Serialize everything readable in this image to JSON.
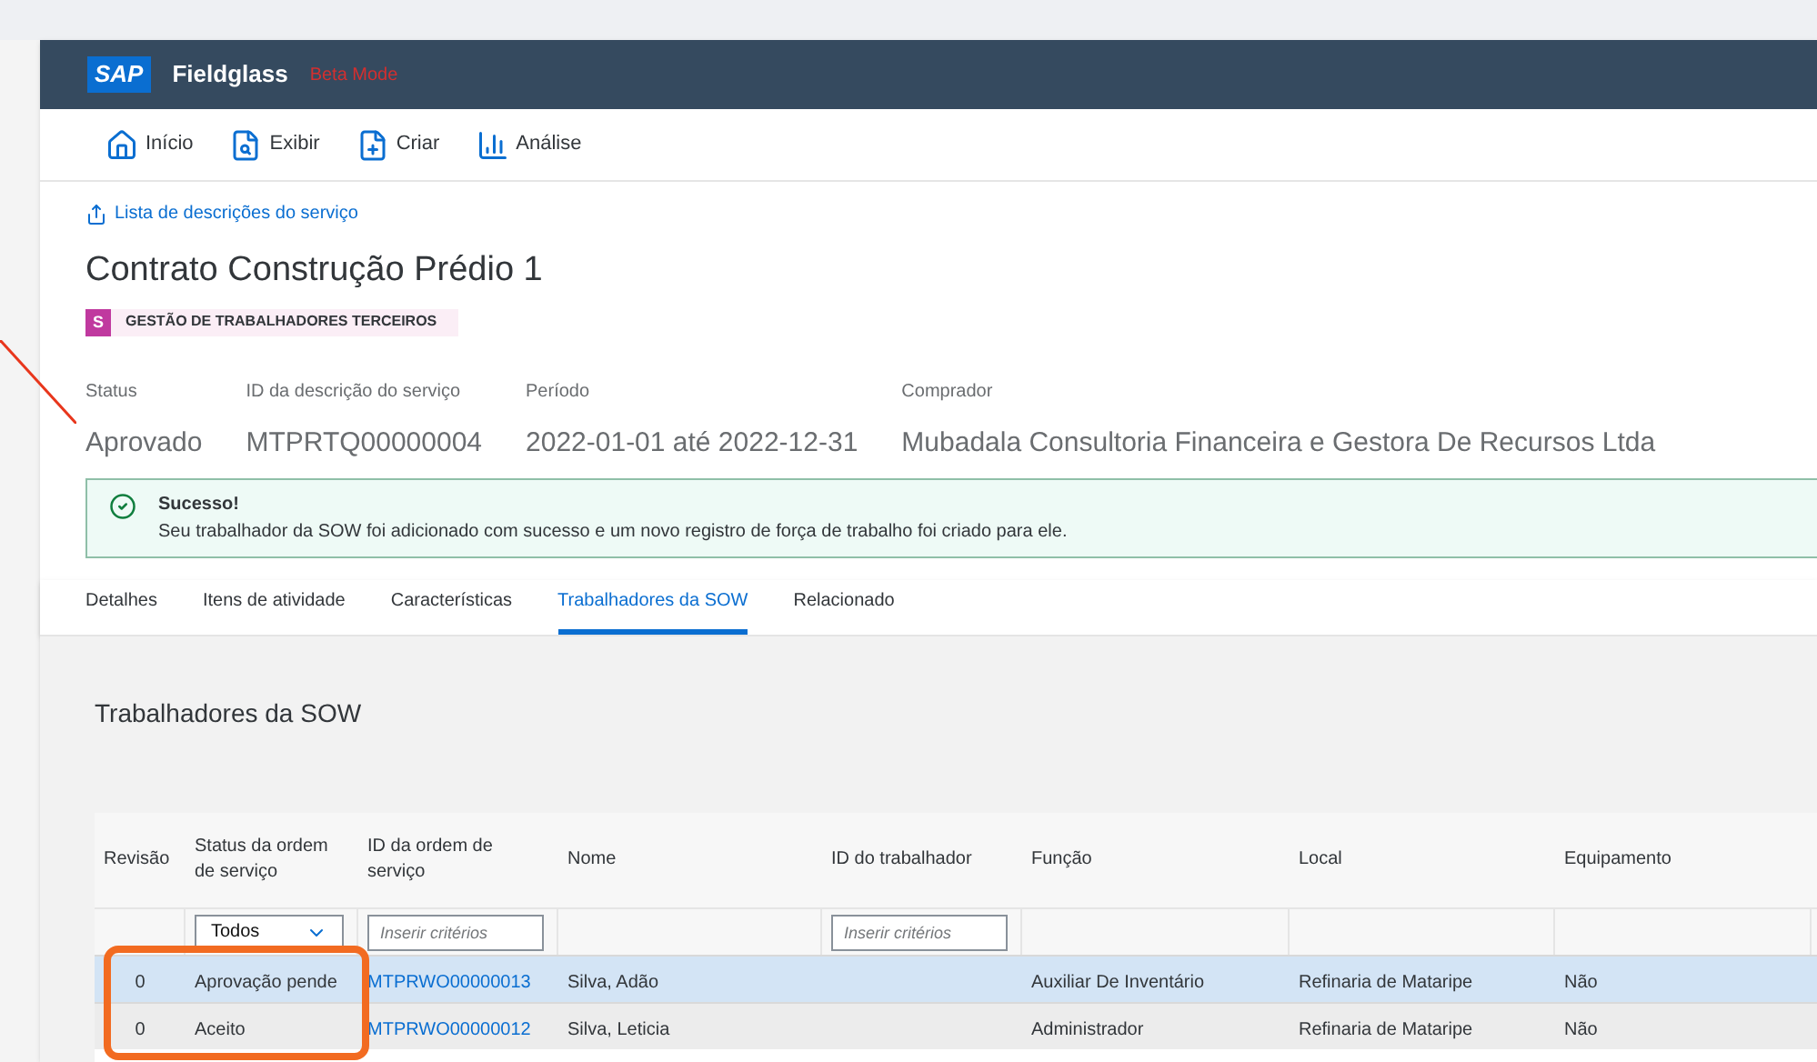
{
  "header": {
    "logo": "SAP",
    "product": "Fieldglass",
    "mode": "Beta Mode"
  },
  "nav": [
    {
      "label": "Início"
    },
    {
      "label": "Exibir"
    },
    {
      "label": "Criar"
    },
    {
      "label": "Análise"
    }
  ],
  "breadcrumb": "Lista de descrições do serviço",
  "title": "Contrato Construção Prédio 1",
  "badge": {
    "letter": "S",
    "label": "GESTÃO DE TRABALHADORES TERCEIROS"
  },
  "fields": [
    {
      "label": "Status",
      "value": "Aprovado"
    },
    {
      "label": "ID da descrição do serviço",
      "value": "MTPRTQ00000004"
    },
    {
      "label": "Período",
      "value": "2022-01-01 até 2022-12-31"
    },
    {
      "label": "Comprador",
      "value": "Mubadala Consultoria Financeira e Gestora De Recursos Ltda"
    }
  ],
  "message": {
    "title": "Sucesso!",
    "text": "Seu trabalhador da SOW foi adicionado com sucesso e um novo registro de força de trabalho foi criado para ele."
  },
  "tabs": [
    {
      "label": "Detalhes",
      "selected": false
    },
    {
      "label": "Itens de atividade",
      "selected": false
    },
    {
      "label": "Características",
      "selected": false
    },
    {
      "label": "Trabalhadores da SOW",
      "selected": true
    },
    {
      "label": "Relacionado",
      "selected": false
    }
  ],
  "section_title": "Trabalhadores da SOW",
  "table": {
    "columns": [
      {
        "label": "Revisão"
      },
      {
        "label": "Status da ordem de serviço",
        "filter": {
          "kind": "select",
          "value": "Todos"
        }
      },
      {
        "label": "ID da ordem de serviço",
        "filter": {
          "kind": "input",
          "placeholder": "Inserir critérios"
        }
      },
      {
        "label": "Nome"
      },
      {
        "label": "ID do trabalhador",
        "filter": {
          "kind": "input",
          "placeholder": "Inserir critérios"
        }
      },
      {
        "label": "Função"
      },
      {
        "label": "Local"
      },
      {
        "label": "Equipamento"
      }
    ],
    "rows": [
      {
        "selected": true,
        "cells": [
          "0",
          "Aprovação pende",
          "MTPRWO00000013",
          "Silva, Adão",
          "",
          "Auxiliar De Inventário",
          "Refinaria de Mataripe",
          "Não"
        ]
      },
      {
        "selected": false,
        "cells": [
          "0",
          "Aceito",
          "MTPRWO00000012",
          "Silva, Leticia",
          "",
          "Administrador",
          "Refinaria de Mataripe",
          "Não"
        ]
      }
    ]
  }
}
